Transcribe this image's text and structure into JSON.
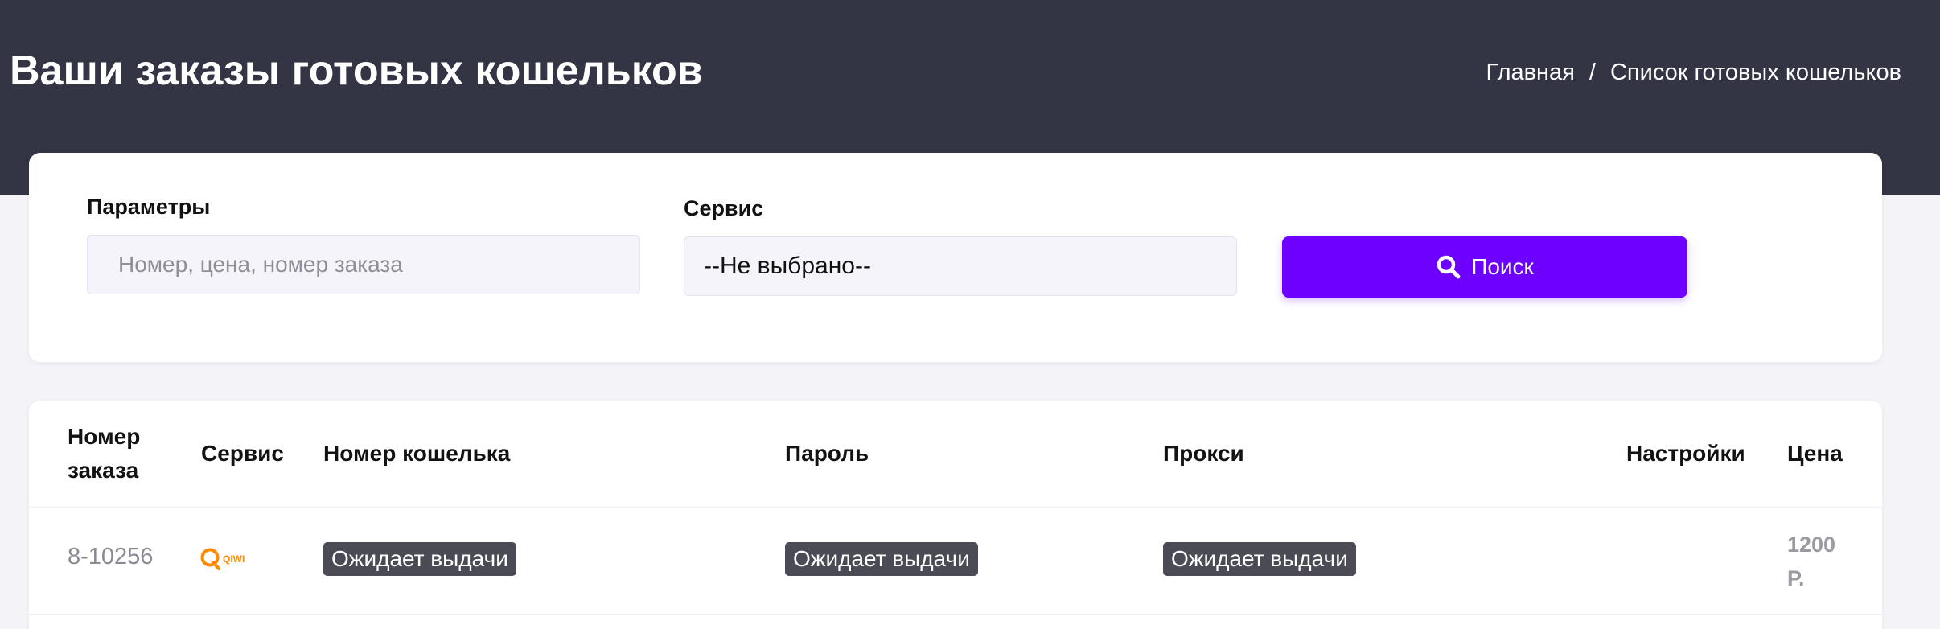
{
  "header": {
    "title": "Ваши заказы готовых кошельков",
    "breadcrumb": {
      "home": "Главная",
      "separator": "/",
      "current": "Список готовых кошельков"
    }
  },
  "filter": {
    "params_label": "Параметры",
    "params_placeholder": "Номер, цена, номер заказа",
    "service_label": "Сервис",
    "service_selected": "--Не выбрано--",
    "search_button": "Поиск",
    "search_icon": "search-icon"
  },
  "table": {
    "columns": [
      "Номер заказа",
      "Сервис",
      "Номер кошелька",
      "Пароль",
      "Прокси",
      "Настройки",
      "Цена"
    ],
    "rows": [
      {
        "order": "8-10256",
        "service_logo": "qiwi",
        "wallet": "Ожидает выдачи",
        "password": "Ожидает выдачи",
        "proxy": "Ожидает выдачи",
        "settings": "",
        "price": "1200 Р."
      }
    ]
  },
  "colors": {
    "header_bg": "#333444",
    "accent": "#6d00ff",
    "badge_bg": "#4a4b55",
    "qiwi_orange": "#ff8c00"
  }
}
